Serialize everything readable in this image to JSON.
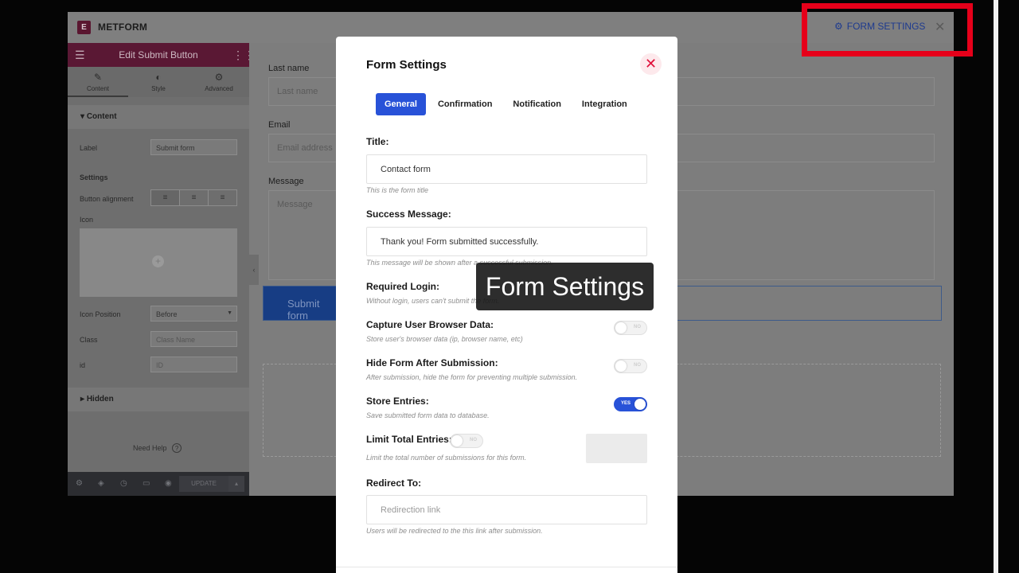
{
  "app": {
    "brand": "METFORM",
    "logo_letter": "E"
  },
  "topbar": {
    "form_settings_label": "FORM SETTINGS",
    "close_glyph": "✕",
    "settings_glyph": "⚙"
  },
  "panel": {
    "title": "Edit Submit Button",
    "tabs": [
      {
        "label": "Content",
        "icon": "✎"
      },
      {
        "label": "Style",
        "icon": "◐"
      },
      {
        "label": "Advanced",
        "icon": "⚙"
      }
    ],
    "content_section": "Content",
    "label_label": "Label",
    "label_value": "Submit form",
    "settings_label": "Settings",
    "button_alignment_label": "Button alignment",
    "alignment_icons": [
      "≡",
      "≡",
      "≡"
    ],
    "icon_label": "Icon",
    "icon_position_label": "Icon Position",
    "icon_position_value": "Before",
    "class_label": "Class",
    "class_placeholder": "Class Name",
    "id_label": "id",
    "id_placeholder": "ID",
    "hidden_section": "Hidden",
    "need_help": "Need Help",
    "update_label": "UPDATE"
  },
  "preview": {
    "last_name_label": "Last name",
    "last_name_placeholder": "Last name",
    "email_label": "Email",
    "email_placeholder": "Email address",
    "message_label": "Message",
    "message_placeholder": "Message",
    "submit_label": "Submit form"
  },
  "modal": {
    "title": "Form Settings",
    "close_glyph": "✕",
    "tabs": [
      "General",
      "Confirmation",
      "Notification",
      "Integration"
    ],
    "active_tab": "General",
    "title_label": "Title:",
    "title_value": "Contact form",
    "title_help": "This is the form title",
    "success_label": "Success Message:",
    "success_value": "Thank you! Form submitted successfully.",
    "success_help": "This message will be shown after a successful submission.",
    "required_login_label": "Required Login:",
    "required_login_help": "Without login, users can't submit the form.",
    "capture_label": "Capture User Browser Data:",
    "capture_help": "Store user's browser data (ip, browser name, etc)",
    "capture_toggle": "NO",
    "hide_label": "Hide Form After Submission:",
    "hide_help": "After submission, hide the form for preventing multiple submission.",
    "hide_toggle": "NO",
    "store_label": "Store Entries:",
    "store_help": "Save submitted form data to database.",
    "store_toggle": "YES",
    "limit_label": "Limit Total Entries:",
    "limit_help": "Limit the total number of submissions for this form.",
    "limit_toggle": "NO",
    "redirect_label": "Redirect To:",
    "redirect_placeholder": "Redirection link",
    "redirect_help": "Users will be redirected to the this link after submission."
  },
  "caption": "Form Settings",
  "colors": {
    "accent": "#2852d8",
    "highlight": "#e6001a",
    "panel_header": "#5a1834"
  }
}
